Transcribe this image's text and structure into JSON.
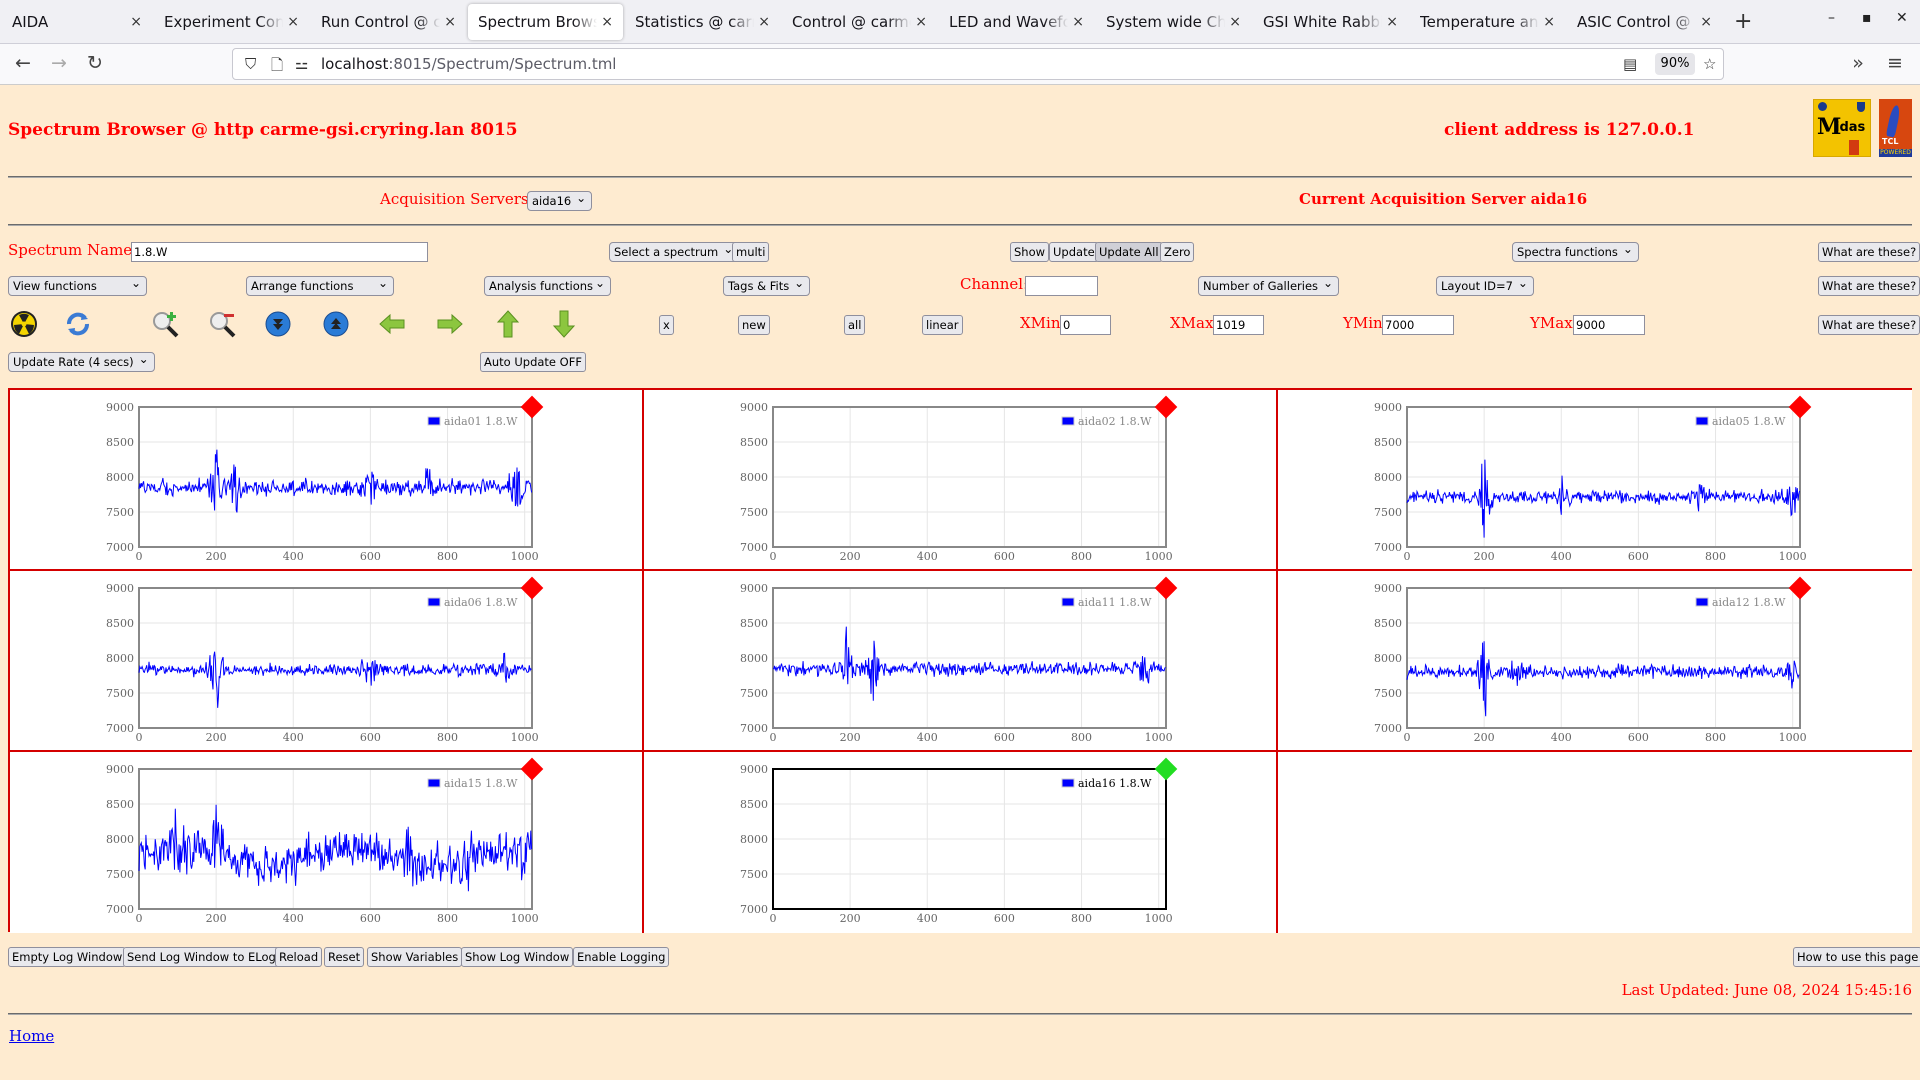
{
  "browser": {
    "tabs": [
      {
        "label": "AIDA",
        "active": false
      },
      {
        "label": "Experiment Control",
        "active": false
      },
      {
        "label": "Run Control @ carme",
        "active": false
      },
      {
        "label": "Spectrum Browser",
        "active": true
      },
      {
        "label": "Statistics @ carme",
        "active": false
      },
      {
        "label": "Control @ carme-gsi",
        "active": false
      },
      {
        "label": "LED and Waveform",
        "active": false
      },
      {
        "label": "System wide Check",
        "active": false
      },
      {
        "label": "GSI White Rabbit T",
        "active": false
      },
      {
        "label": "Temperature and st",
        "active": false
      },
      {
        "label": "ASIC Control @ carme",
        "active": false
      }
    ],
    "url_host": "localhost",
    "url_rest": ":8015/Spectrum/Spectrum.tml",
    "zoom": "90%"
  },
  "header": {
    "title": "Spectrum Browser @ http carme-gsi.cryring.lan 8015",
    "client_address": "client address is 127.0.0.1",
    "logos": [
      "Midas",
      "TCL POWERED"
    ]
  },
  "servers": {
    "label": "Acquisition Servers",
    "selected": "aida16",
    "current": "Current Acquisition Server aida16"
  },
  "controls": {
    "spectrum_name_label": "Spectrum Name:",
    "spectrum_name_value": "1.8.W",
    "select_spectrum": "Select a spectrum",
    "multi": "multi",
    "show": "Show",
    "update": "Update",
    "update_all": "Update All",
    "zero": "Zero",
    "spectra_functions": "Spectra functions",
    "what_are_these": "What are these?",
    "view_functions": "View functions",
    "arrange_functions": "Arrange functions",
    "analysis_functions": "Analysis functions",
    "tags_fits": "Tags & Fits",
    "channel_label": "Channel:",
    "channel_value": "",
    "number_of_galleries": "Number of Galleries",
    "layout_id": "Layout ID=7",
    "x_btn": "x",
    "new_btn": "new",
    "all_btn": "all",
    "linear_btn": "linear",
    "xmin_label": "XMin",
    "xmin_value": "0",
    "xmax_label": "XMax",
    "xmax_value": "1019",
    "ymin_label": "YMin",
    "ymin_value": "7000",
    "ymax_label": "YMax",
    "ymax_value": "9000",
    "update_rate": "Update Rate (4 secs)",
    "auto_update": "Auto Update OFF"
  },
  "toolbar_icons": [
    "radiation-icon",
    "refresh-icon",
    "zoom-in-icon",
    "zoom-out-icon",
    "scroll-down-icon",
    "scroll-up-icon",
    "arrow-left-icon",
    "arrow-right-icon",
    "arrow-up-icon",
    "arrow-down-icon"
  ],
  "chart_data": [
    {
      "type": "line",
      "legend": "aida01 1.8.W",
      "status": "red",
      "xlim": [
        0,
        1019
      ],
      "ylim": [
        7000,
        9000
      ],
      "xticks": [
        0,
        200,
        400,
        600,
        800,
        1000
      ],
      "yticks": [
        7000,
        7500,
        8000,
        8500,
        9000
      ],
      "baseline": 7850,
      "noise": 90,
      "spikes": [
        [
          200,
          700
        ],
        [
          250,
          500
        ],
        [
          600,
          450
        ],
        [
          750,
          400
        ],
        [
          980,
          500
        ]
      ]
    },
    {
      "type": "line",
      "legend": "aida02 1.8.W",
      "status": "red",
      "xlim": [
        0,
        1019
      ],
      "ylim": [
        7000,
        9000
      ],
      "xticks": [
        0,
        200,
        400,
        600,
        800,
        1000
      ],
      "yticks": [
        7000,
        7500,
        8000,
        8500,
        9000
      ],
      "empty": true
    },
    {
      "type": "line",
      "legend": "aida05 1.8.W",
      "status": "red",
      "xlim": [
        0,
        1019
      ],
      "ylim": [
        7000,
        9000
      ],
      "xticks": [
        0,
        200,
        400,
        600,
        800,
        1000
      ],
      "yticks": [
        7000,
        7500,
        8000,
        8500,
        9000
      ],
      "baseline": 7720,
      "noise": 80,
      "spikes": [
        [
          200,
          800
        ],
        [
          400,
          350
        ],
        [
          760,
          350
        ],
        [
          1000,
          300
        ]
      ]
    },
    {
      "type": "line",
      "legend": "aida06 1.8.W",
      "status": "red",
      "xlim": [
        0,
        1019
      ],
      "ylim": [
        7000,
        9000
      ],
      "xticks": [
        0,
        200,
        400,
        600,
        800,
        1000
      ],
      "yticks": [
        7000,
        7500,
        8000,
        8500,
        9000
      ],
      "baseline": 7830,
      "noise": 70,
      "spikes": [
        [
          200,
          750
        ],
        [
          600,
          300
        ],
        [
          950,
          300
        ]
      ]
    },
    {
      "type": "line",
      "legend": "aida11 1.8.W",
      "status": "red",
      "xlim": [
        0,
        1019
      ],
      "ylim": [
        7000,
        9000
      ],
      "xticks": [
        0,
        200,
        400,
        600,
        800,
        1000
      ],
      "yticks": [
        7000,
        7500,
        8000,
        8500,
        9000
      ],
      "baseline": 7850,
      "noise": 80,
      "spikes": [
        [
          190,
          650
        ],
        [
          260,
          500
        ],
        [
          960,
          300
        ]
      ]
    },
    {
      "type": "line",
      "legend": "aida12 1.8.W",
      "status": "red",
      "xlim": [
        0,
        1019
      ],
      "ylim": [
        7000,
        9000
      ],
      "xticks": [
        0,
        200,
        400,
        600,
        800,
        1000
      ],
      "yticks": [
        7000,
        7500,
        8000,
        8500,
        9000
      ],
      "baseline": 7800,
      "noise": 75,
      "spikes": [
        [
          200,
          800
        ],
        [
          280,
          400
        ],
        [
          1000,
          300
        ]
      ]
    },
    {
      "type": "line",
      "legend": "aida15 1.8.W",
      "status": "red",
      "xlim": [
        0,
        1019
      ],
      "ylim": [
        7000,
        9000
      ],
      "xticks": [
        0,
        200,
        400,
        600,
        800,
        1000
      ],
      "yticks": [
        7000,
        7500,
        8000,
        8500,
        9000
      ],
      "baseline": 7750,
      "noise": 220,
      "spikes": [
        [
          100,
          650
        ],
        [
          200,
          900
        ],
        [
          400,
          400
        ],
        [
          700,
          450
        ],
        [
          850,
          700
        ],
        [
          1000,
          500
        ]
      ],
      "wavy": true
    },
    {
      "type": "line",
      "legend": "aida16 1.8.W",
      "status": "green",
      "xlim": [
        0,
        1019
      ],
      "ylim": [
        7000,
        9000
      ],
      "xticks": [
        0,
        200,
        400,
        600,
        800,
        1000
      ],
      "yticks": [
        7000,
        7500,
        8000,
        8500,
        9000
      ],
      "empty": true,
      "selected": true
    }
  ],
  "footer": {
    "buttons": [
      "Empty Log Window",
      "Send Log Window to ELog",
      "Reload",
      "Reset",
      "Show Variables",
      "Show Log Window",
      "Enable Logging"
    ],
    "help": "How to use this page",
    "last_updated": "Last Updated: June 08, 2024 15:45:16",
    "home": "Home"
  },
  "colors": {
    "accent_red": "#ff0000",
    "border_red": "#d40000",
    "trace_blue": "#0000ff",
    "status_red": "#ff0000",
    "status_green": "#22dd22",
    "page_bg": "#feebd0"
  }
}
